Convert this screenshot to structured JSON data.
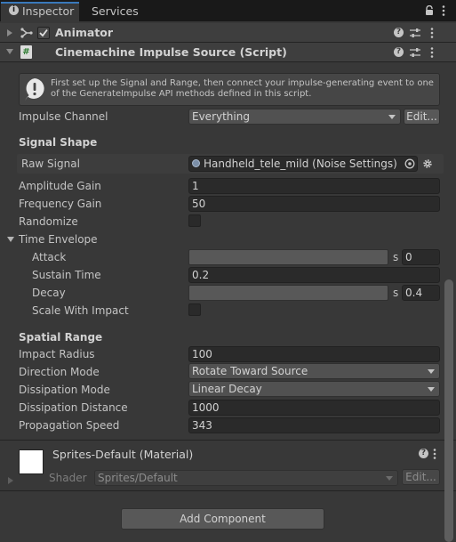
{
  "tabs": {
    "inspector": "Inspector",
    "services": "Services"
  },
  "icons": {
    "lock": "lock-icon",
    "more": "kebab-menu-icon"
  },
  "animator": {
    "title": "Animator"
  },
  "component": {
    "title": "Cinemachine Impulse Source (Script)",
    "script_icon_glyph": "#",
    "info_text": "First set up the Signal and Range, then connect your impulse-generating event to one of the GenerateImpulse API methods defined in this script.",
    "impulse_channel_label": "Impulse Channel",
    "impulse_channel_value": "Everything",
    "edit_label": "Edit...",
    "signal_shape_heading": "Signal Shape",
    "raw_signal_label": "Raw Signal",
    "raw_signal_value": "Handheld_tele_mild (Noise Settings)",
    "amplitude_gain_label": "Amplitude Gain",
    "amplitude_gain_value": "1",
    "frequency_gain_label": "Frequency Gain",
    "frequency_gain_value": "50",
    "randomize_label": "Randomize",
    "randomize_checked": false,
    "time_envelope_label": "Time Envelope",
    "attack_label": "Attack",
    "attack_unit": "s",
    "attack_value": "0",
    "sustain_time_label": "Sustain Time",
    "sustain_time_value": "0.2",
    "decay_label": "Decay",
    "decay_unit": "s",
    "decay_value": "0.4",
    "scale_with_impact_label": "Scale With Impact",
    "scale_with_impact_checked": false,
    "spatial_range_heading": "Spatial Range",
    "impact_radius_label": "Impact Radius",
    "impact_radius_value": "100",
    "direction_mode_label": "Direction Mode",
    "direction_mode_value": "Rotate Toward Source",
    "dissipation_mode_label": "Dissipation Mode",
    "dissipation_mode_value": "Linear Decay",
    "dissipation_distance_label": "Dissipation Distance",
    "dissipation_distance_value": "1000",
    "propagation_speed_label": "Propagation Speed",
    "propagation_speed_value": "343"
  },
  "material": {
    "title": "Sprites-Default (Material)",
    "shader_label": "Shader",
    "shader_value": "Sprites/Default",
    "edit_label": "Edit..."
  },
  "footer": {
    "add_component_label": "Add Component"
  },
  "colors": {
    "background": "#383838",
    "tab_accent": "#3a79bb",
    "field_bg": "#2a2a2a",
    "dropdown_bg": "#515151"
  }
}
